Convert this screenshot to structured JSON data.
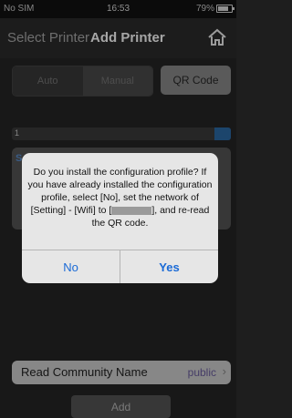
{
  "status": {
    "carrier": "No SIM",
    "time": "16:53",
    "battery": "79%"
  },
  "navbar": {
    "back": "Select Printer",
    "title": "Add Printer"
  },
  "mode": {
    "auto": "Auto",
    "manual": "Manual",
    "qr": "QR Code"
  },
  "card": {
    "letter": "S"
  },
  "row_hint": {
    "prefix": "1"
  },
  "community": {
    "label": "Read Community Name",
    "value": "public"
  },
  "add_button": "Add",
  "dialog": {
    "line1": "Do you install the configuration profile? If you have already installed the configuration profile, select [No], set the network of [Setting] - [Wifi] to [",
    "line2": "], and re-read the QR code.",
    "no": "No",
    "yes": "Yes"
  },
  "colors": {
    "accent": "#1a6ad6",
    "community_value": "#6a5d9e"
  }
}
